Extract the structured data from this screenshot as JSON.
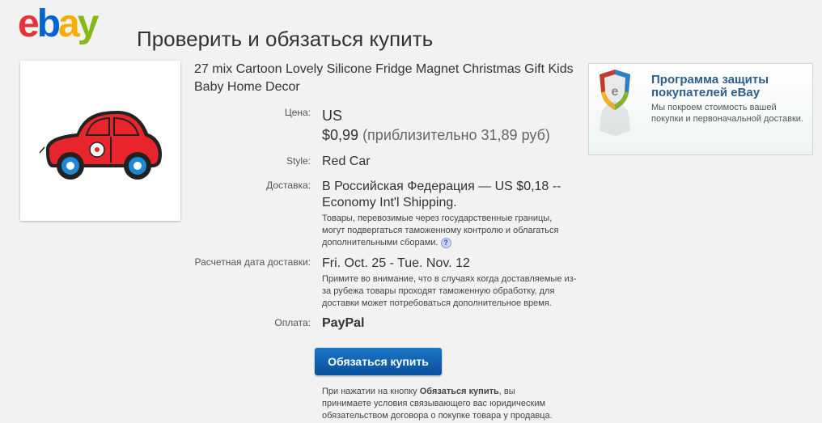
{
  "logo": {
    "letters": [
      "e",
      "b",
      "a",
      "y"
    ]
  },
  "page_title": "Проверить и обязаться купить",
  "item": {
    "title": "27 mix Cartoon Lovely Silicone Fridge Magnet Christmas Gift Kids Baby Home Decor",
    "image_icon": "red-car-magnet"
  },
  "details": {
    "price_label": "Цена:",
    "price_currency": "US",
    "price_value": "$0,99",
    "price_approx": "(приблизительно 31,89 руб)",
    "style_label": "Style:",
    "style_value": "Red Car",
    "shipping_label": "Доставка:",
    "shipping_value": "В Российская Федерация — US $0,18 -- Economy Int'l Shipping.",
    "shipping_note": "Товары, перевозимые через государственные границы, могут подвергаться таможенному контролю и облагаться дополнительными сборами.",
    "help_icon": "?",
    "delivery_label": "Расчетная дата доставки:",
    "delivery_value": "Fri. Oct. 25 - Tue. Nov. 12",
    "delivery_note": "Примите во внимание, что в случаях когда доставляемые из-за рубежа товары проходят таможенную обработку, для доставки может потребоваться дополнительное время.",
    "payment_label": "Оплата:",
    "payment_value": "PayPal"
  },
  "commit_button": "Обязаться купить",
  "disclaimer": {
    "part1": "При нажатии на кнопку ",
    "bold": "Обязаться купить",
    "part2": ", вы принимаете условия связывающего вас юридическим обязательством договора о покупке товара у продавца."
  },
  "protection": {
    "title": "Программа защиты покупателей eBay",
    "description": "Мы покроем стоимость вашей покупки и первоначальной доставки.",
    "icon": "shield-icon"
  },
  "colors": {
    "ebay_red": "#e53238",
    "ebay_blue": "#0064d2",
    "ebay_yellow": "#f5af02",
    "ebay_green": "#86b817",
    "button_blue": "#0a4f9c"
  }
}
